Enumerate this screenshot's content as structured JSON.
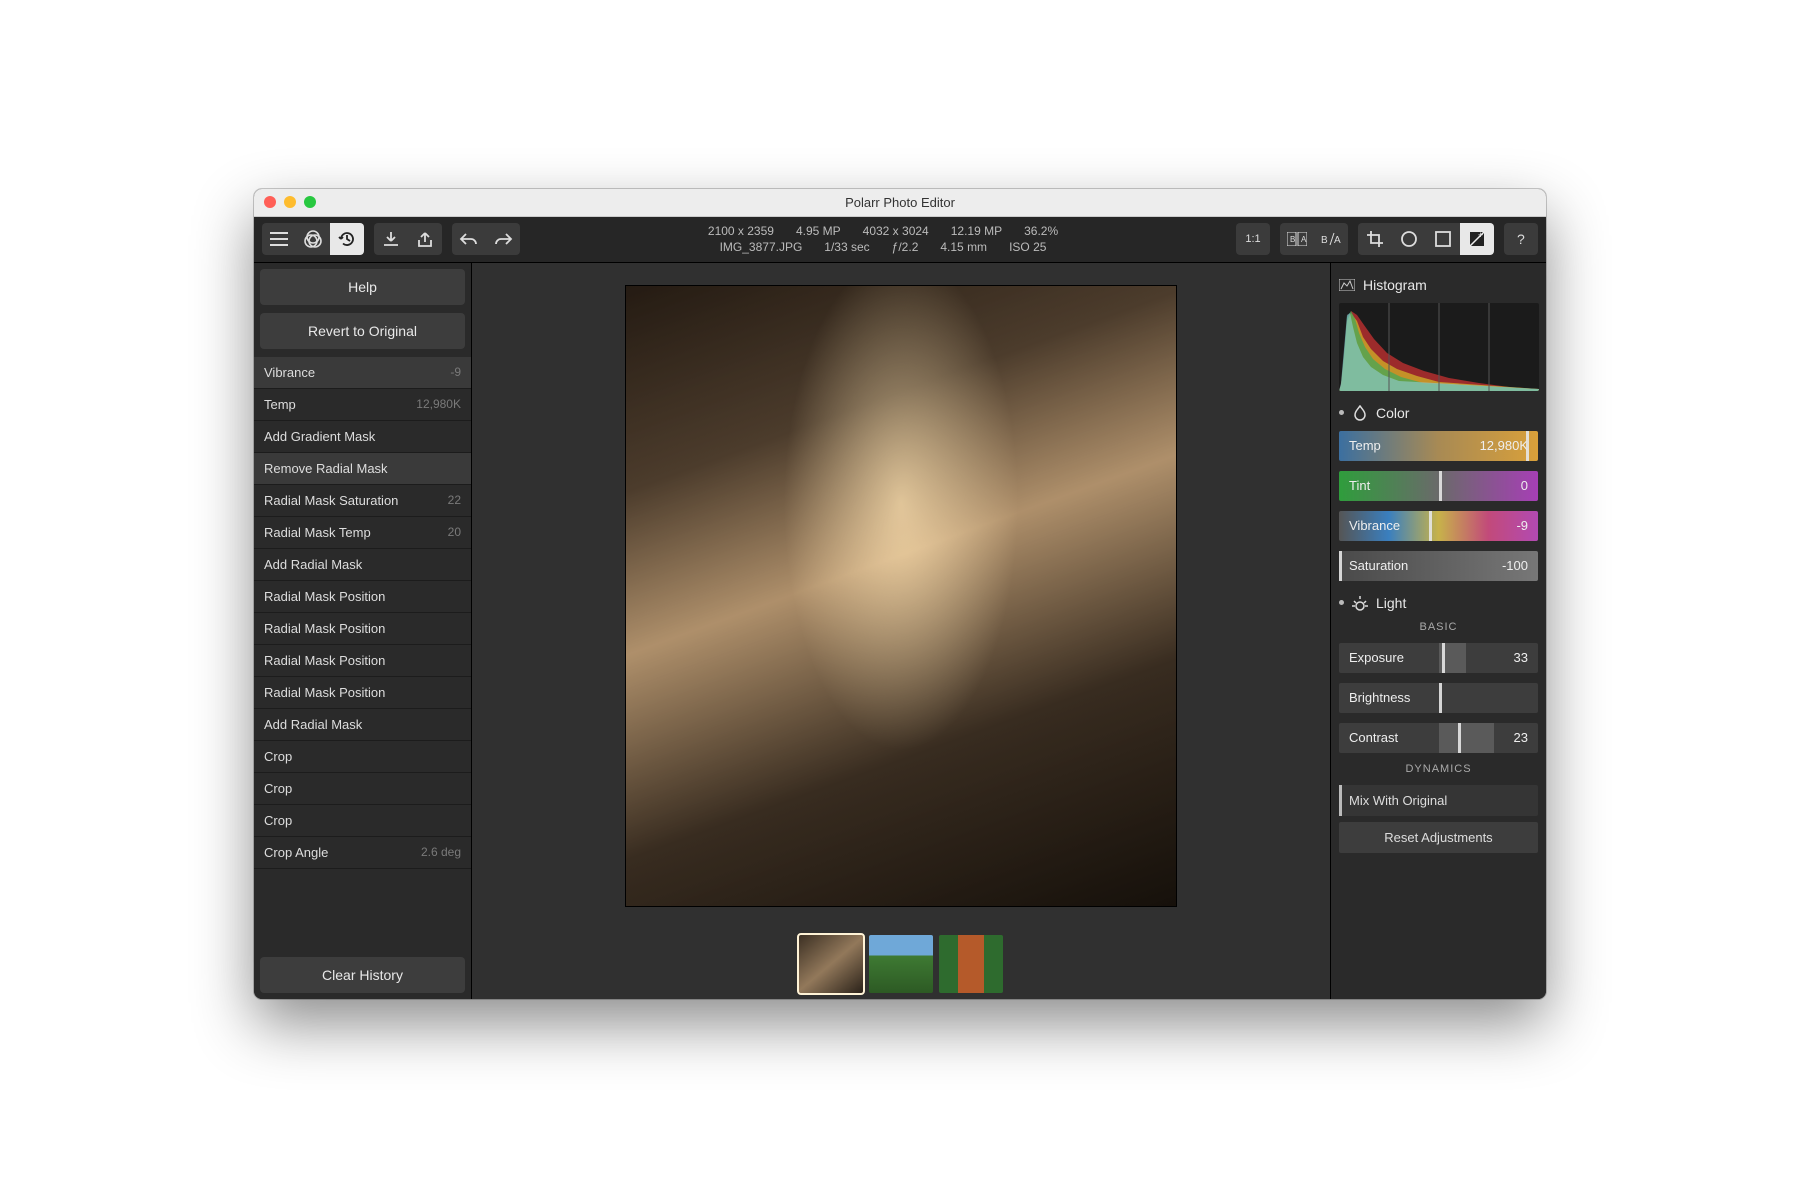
{
  "window": {
    "title": "Polarr Photo Editor"
  },
  "meta": {
    "row1": {
      "dim1": "2100 x 2359",
      "mp1": "4.95 MP",
      "dim2": "4032 x 3024",
      "mp2": "12.19 MP",
      "zoom": "36.2%"
    },
    "row2": {
      "file": "IMG_3877.JPG",
      "shutter": "1/33 sec",
      "fstop": "ƒ/2.2",
      "focal": "4.15 mm",
      "iso": "ISO 25"
    }
  },
  "toolbar": {
    "oneToOne": "1:1",
    "ba1": "B|A",
    "ba2": "B/A"
  },
  "left": {
    "help": "Help",
    "revert": "Revert to Original",
    "clear": "Clear History",
    "history": [
      {
        "label": "Vibrance",
        "value": "-9",
        "active": true
      },
      {
        "label": "Temp",
        "value": "12,980K"
      },
      {
        "label": "Add Gradient Mask",
        "value": ""
      },
      {
        "label": "Remove Radial Mask",
        "value": "",
        "active": true
      },
      {
        "label": "Radial Mask Saturation",
        "value": "22"
      },
      {
        "label": "Radial Mask Temp",
        "value": "20"
      },
      {
        "label": "Add Radial Mask",
        "value": ""
      },
      {
        "label": "Radial Mask Position",
        "value": ""
      },
      {
        "label": "Radial Mask Position",
        "value": ""
      },
      {
        "label": "Radial Mask Position",
        "value": ""
      },
      {
        "label": "Radial Mask Position",
        "value": ""
      },
      {
        "label": "Add Radial Mask",
        "value": ""
      },
      {
        "label": "Crop",
        "value": ""
      },
      {
        "label": "Crop",
        "value": ""
      },
      {
        "label": "Crop",
        "value": ""
      },
      {
        "label": "Crop Angle",
        "value": "2.6 deg"
      }
    ]
  },
  "right": {
    "histogram": "Histogram",
    "color": "Color",
    "light": "Light",
    "basic": "BASIC",
    "dynamics": "DYNAMICS",
    "temp": {
      "label": "Temp",
      "value": "12,980K",
      "handle": 94
    },
    "tint": {
      "label": "Tint",
      "value": "0",
      "handle": 50
    },
    "vibrance": {
      "label": "Vibrance",
      "value": "-9",
      "handle": 45
    },
    "saturation": {
      "label": "Saturation",
      "value": "-100",
      "handle": 0
    },
    "exposure": {
      "label": "Exposure",
      "value": "33",
      "handle": 52,
      "fill": 14
    },
    "brightness": {
      "label": "Brightness",
      "value": "",
      "handle": 50,
      "fill": 0
    },
    "contrast": {
      "label": "Contrast",
      "value": "23",
      "handle": 60,
      "fill": 28
    },
    "mix": "Mix With Original",
    "reset": "Reset Adjustments"
  }
}
